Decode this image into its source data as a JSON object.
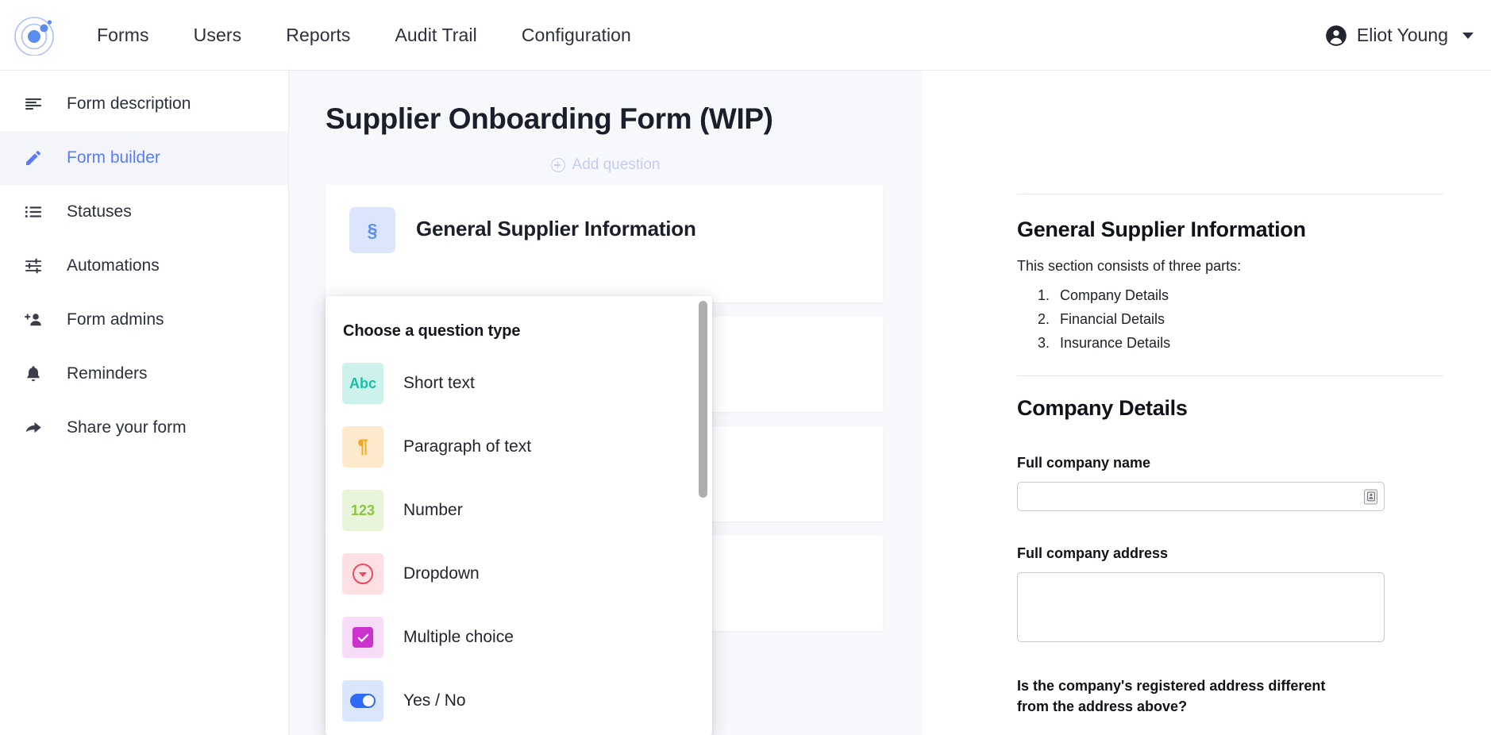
{
  "topnav": {
    "logo_name": "orbit-logo",
    "items": [
      {
        "label": "Forms"
      },
      {
        "label": "Users"
      },
      {
        "label": "Reports"
      },
      {
        "label": "Audit Trail"
      },
      {
        "label": "Configuration"
      }
    ],
    "user": {
      "name": "Eliot Young",
      "avatar_icon": "account-circle-icon",
      "caret_icon": "chevron-down-icon"
    }
  },
  "sidebar": {
    "items": [
      {
        "label": "Form description",
        "icon": "text-align-left-icon",
        "active": false
      },
      {
        "label": "Form builder",
        "icon": "pencil-icon",
        "active": true
      },
      {
        "label": "Statuses",
        "icon": "list-bullet-icon",
        "active": false
      },
      {
        "label": "Automations",
        "icon": "sliders-icon",
        "active": false
      },
      {
        "label": "Form admins",
        "icon": "person-add-icon",
        "active": false
      },
      {
        "label": "Reminders",
        "icon": "bell-icon",
        "active": false
      },
      {
        "label": "Share your form",
        "icon": "share-arrow-icon",
        "active": false
      }
    ]
  },
  "main": {
    "page_title": "Supplier Onboarding Form (WIP)",
    "add_question_label": "Add question",
    "add_question_icon": "plus-circle-icon",
    "section": {
      "badge_glyph": "§",
      "badge_icon": "section-symbol-icon",
      "title": "General Supplier Information"
    }
  },
  "popup": {
    "title": "Choose a question type",
    "question_types": [
      {
        "label": "Short text",
        "icon": "abc-icon",
        "glyph": "Abc",
        "fg": "#16bfa6",
        "bg": "#cdf2ec"
      },
      {
        "label": "Paragraph of text",
        "icon": "pilcrow-icon",
        "glyph": "¶",
        "fg": "#f6a623",
        "bg": "#fdeacd"
      },
      {
        "label": "Number",
        "icon": "123-icon",
        "glyph": "123",
        "fg": "#8cc63f",
        "bg": "#e9f5da"
      },
      {
        "label": "Dropdown",
        "icon": "dropdown-circle-icon",
        "glyph": "",
        "fg": "#f0485f",
        "bg": "#fde0e3"
      },
      {
        "label": "Multiple choice",
        "icon": "checkbox-icon",
        "glyph": "",
        "fg": "#cc33cc",
        "bg": "#f7dcf7"
      },
      {
        "label": "Yes / No",
        "icon": "toggle-switch-icon",
        "glyph": "",
        "fg": "#2f6bf5",
        "bg": "#dae6fb"
      }
    ],
    "scrollbar_icon": "vertical-scrollbar"
  },
  "preview": {
    "section_heading": "General Supplier Information",
    "intro": "This section consists of three parts:",
    "parts": [
      "Company Details",
      "Financial Details",
      "Insurance Details"
    ],
    "subsection_heading": "Company Details",
    "fields": [
      {
        "label": "Full company name",
        "value": "",
        "type": "text",
        "autofill_icon": "contact-card-icon"
      },
      {
        "label": "Full company address",
        "value": "",
        "type": "textarea"
      }
    ],
    "question": "Is the company's registered address different from the address above?"
  },
  "colors": {
    "accent_blue": "#5b7cfa",
    "page_bg": "#f7f8fb",
    "text_dark": "#1c1f2b"
  }
}
